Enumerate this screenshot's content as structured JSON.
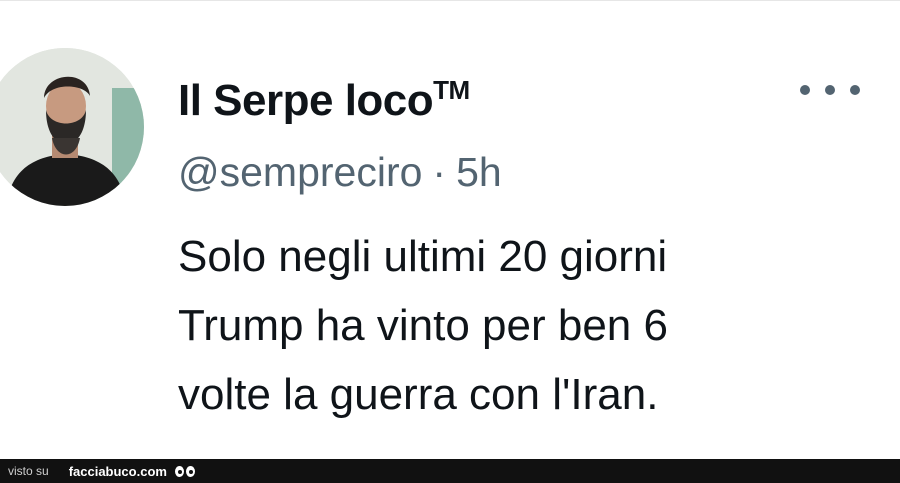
{
  "tweet": {
    "display_name": "Il Serpe loco",
    "trademark": "TM",
    "handle": "@sempreciro",
    "separator": "·",
    "time": "5h",
    "lines": [
      "Solo negli ultimi 20 giorni",
      "Trump ha vinto per ben 6",
      "volte la guerra con l'Iran."
    ],
    "more_icon": "more-horizontal-icon"
  },
  "footer": {
    "visto": "visto su",
    "brand": "facciabuco.com",
    "logo_icon": "eyes-icon"
  }
}
